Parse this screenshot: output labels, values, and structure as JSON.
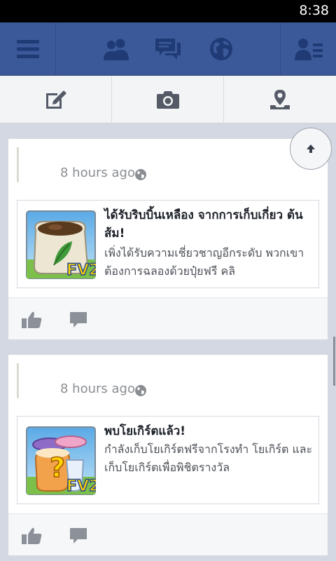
{
  "status_bar": {
    "time": "8:38"
  },
  "top_nav": {
    "icons": [
      "menu-icon",
      "friends-icon",
      "messages-icon",
      "notifications-globe-icon",
      "friend-requests-icon"
    ]
  },
  "action_bar": {
    "icons": [
      "status-icon",
      "photo-icon",
      "check-in-icon"
    ]
  },
  "feed": {
    "posts": [
      {
        "time": "8 hours ago",
        "privacy_icon": "globe-icon",
        "attachment": {
          "title": "ได้รับริบบิ้นเหลือง จากการเก็บเกี่ยว ต้นส้ม!",
          "description": "เพิ่งได้รับความเชี่ยวชาญอีกระดับ พวกเขาต้องการฉลองด้วยปุ๋ยฟรี คลิ",
          "thumb_badge": "FV2"
        }
      },
      {
        "time": "8 hours ago",
        "privacy_icon": "globe-icon",
        "attachment": {
          "title": "พบโยเกิร์ตแล้ว!",
          "description": "กำลังเก็บโยเกิร์ตฟรีจากโรงทำ โยเกิร์ต และเก็บโยเกิร์ตเพื่อพิชิตรางวัล",
          "thumb_badge": "FV2"
        }
      }
    ]
  },
  "colors": {
    "nav": "#3b5998",
    "nav_icon": "#1f3a75",
    "action_icon": "#545a66"
  }
}
